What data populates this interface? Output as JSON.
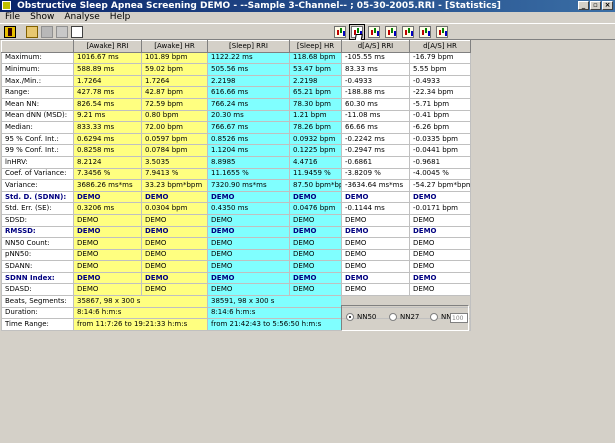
{
  "window": {
    "title": "Obstructive Sleep Apnea Screening DEMO  - --Sample 3-Channel-- ; 05-30-2005.RRI  - [Statistics]",
    "controls": [
      "_",
      "▫",
      "×"
    ]
  },
  "menu": [
    "File",
    "Show",
    "Analyse",
    "Help"
  ],
  "table": {
    "headers": [
      "",
      "[Awake] RRI",
      "[Awake] HR",
      "[Sleep] RRI",
      "[Sleep] HR",
      "d[A/S] RRI",
      "d[A/S] HR"
    ],
    "rows": [
      {
        "label": "Maximum:",
        "cells": [
          "1016.67  ms",
          "101.89  bpm",
          "1122.22  ms",
          "118.68  bpm",
          "-105.55  ms",
          "-16.79  bpm"
        ]
      },
      {
        "label": "Minimum:",
        "cells": [
          "588.89  ms",
          "59.02  bpm",
          "505.56  ms",
          "53.47  bpm",
          "83.33  ms",
          "5.55  bpm"
        ]
      },
      {
        "label": "Max./Min.:",
        "cells": [
          "1.7264",
          "1.7264",
          "2.2198",
          "2.2198",
          "-0.4933",
          "-0.4933"
        ]
      },
      {
        "label": "Range:",
        "cells": [
          "427.78  ms",
          "42.87  bpm",
          "616.66  ms",
          "65.21  bpm",
          "-188.88  ms",
          "-22.34  bpm"
        ]
      },
      {
        "label": "Mean NN:",
        "cells": [
          "826.54  ms",
          "72.59  bpm",
          "766.24  ms",
          "78.30  bpm",
          "60.30  ms",
          "-5.71  bpm"
        ]
      },
      {
        "label": "Mean dNN (MSD):",
        "cells": [
          "9.21  ms",
          "0.80  bpm",
          "20.30  ms",
          "1.21  bpm",
          "-11.08  ms",
          "-0.41  bpm"
        ]
      },
      {
        "label": "Median:",
        "cells": [
          "833.33  ms",
          "72.00  bpm",
          "766.67  ms",
          "78.26  bpm",
          "66.66  ms",
          "-6.26  bpm"
        ]
      },
      {
        "label": "95 % Conf. Int.:",
        "cells": [
          "0.6294  ms",
          "0.0597  bpm",
          "0.8526  ms",
          "0.0932  bpm",
          "-0.2242  ms",
          "-0.0335  bpm"
        ]
      },
      {
        "label": "99 % Conf. Int.:",
        "cells": [
          "0.8258  ms",
          "0.0784  bpm",
          "1.1204  ms",
          "0.1225  bpm",
          "-0.2947  ms",
          "-0.0441  bpm"
        ]
      },
      {
        "label": "lnHRV:",
        "cells": [
          "8.2124",
          "3.5035",
          "8.8985",
          "4.4716",
          "-0.6861",
          "-0.9681"
        ]
      },
      {
        "label": "Coef. of Variance:",
        "cells": [
          "7.3456  %",
          "7.9413  %",
          "11.1655  %",
          "11.9459  %",
          "-3.8209  %",
          "-4.0045  %"
        ]
      },
      {
        "label": "Variance:",
        "cells": [
          "3686.26  ms*ms",
          "33.23  bpm*bpm",
          "7320.90  ms*ms",
          "87.50  bpm*bpm",
          "-3634.64  ms*ms",
          "-54.27  bpm*bpm"
        ]
      },
      {
        "label": "Std. D. (SDNN):",
        "demo": true,
        "cells": [
          "DEMO",
          "DEMO",
          "DEMO",
          "DEMO",
          "DEMO",
          "DEMO"
        ]
      },
      {
        "label": "Std. Err. (SE):",
        "cells": [
          "0.3206  ms",
          "0.0304  bpm",
          "0.4350  ms",
          "0.0476  bpm",
          "-0.1144  ms",
          "-0.0171  bpm"
        ]
      },
      {
        "label": "SDSD:",
        "cells": [
          "DEMO",
          "DEMO",
          "DEMO",
          "DEMO",
          "DEMO",
          "DEMO"
        ]
      },
      {
        "label": "RMSSD:",
        "demo": true,
        "cells": [
          "DEMO",
          "DEMO",
          "DEMO",
          "DEMO",
          "DEMO",
          "DEMO"
        ]
      },
      {
        "label": "NN50 Count:",
        "cells": [
          "DEMO",
          "DEMO",
          "DEMO",
          "DEMO",
          "DEMO",
          "DEMO"
        ]
      },
      {
        "label": "pNN50:",
        "cells": [
          "DEMO",
          "DEMO",
          "DEMO",
          "DEMO",
          "DEMO",
          "DEMO"
        ]
      },
      {
        "label": "SDANN:",
        "cells": [
          "DEMO",
          "DEMO",
          "DEMO",
          "DEMO",
          "DEMO",
          "DEMO"
        ]
      },
      {
        "label": "SDNN Index:",
        "demo": true,
        "cells": [
          "DEMO",
          "DEMO",
          "DEMO",
          "DEMO",
          "DEMO",
          "DEMO"
        ]
      },
      {
        "label": "SDASD:",
        "cells": [
          "DEMO",
          "DEMO",
          "DEMO",
          "DEMO",
          "DEMO",
          "DEMO"
        ]
      }
    ],
    "summary": [
      {
        "label": "Beats, Segments:",
        "awake": "35867,   98 x 300 s",
        "sleep": "38591,   98 x 300 s"
      },
      {
        "label": "Duration:",
        "awake": "8:14:6 h:m:s",
        "sleep": "8:14:6 h:m:s"
      },
      {
        "label": "Time Range:",
        "awake": "from 11:7:26 to 19:21:33 h:m:s",
        "sleep": "from 21:42:43 to 5:56:50 h:m:s"
      }
    ]
  },
  "nn_options": {
    "selected": "NN50",
    "options": [
      "NN50",
      "NN27",
      "NN"
    ],
    "custom_value": "100"
  }
}
